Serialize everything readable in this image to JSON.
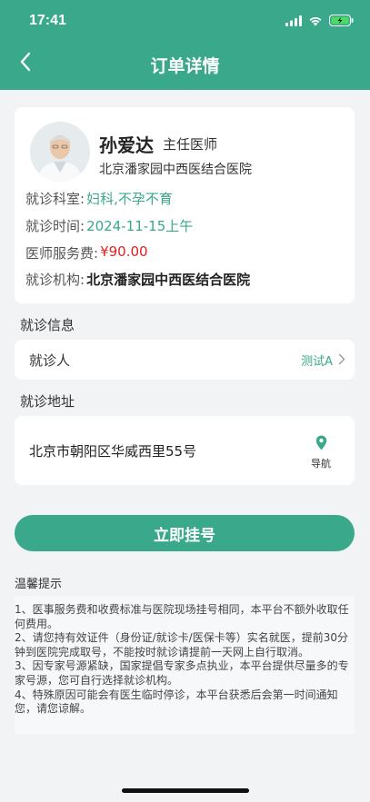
{
  "status_bar": {
    "time": "17:41"
  },
  "nav": {
    "title": "订单详情"
  },
  "doctor": {
    "name": "孙爱达",
    "title": "主任医师",
    "hospital": "北京潘家园中西医结合医院",
    "department_label": "就诊科室:",
    "department": "妇科,不孕不育",
    "time_label": "就诊时间:",
    "time": "2024-11-15上午",
    "fee_label": "医师服务费:",
    "fee": "¥90.00",
    "institution_label": "就诊机构:",
    "institution": "北京潘家园中西医结合医院"
  },
  "visit_info": {
    "section_title": "就诊信息",
    "patient_label": "就诊人",
    "patient_value": "测试A"
  },
  "address": {
    "section_title": "就诊地址",
    "text": "北京市朝阳区华威西里55号",
    "nav_label": "导航"
  },
  "register_button": "立即挂号",
  "tips": {
    "title": "温馨提示",
    "items": [
      "1、医事服务费和收费标准与医院现场挂号相同，本平台不额外收取任何费用。",
      "2、请您持有效证件（身份证/就诊卡/医保卡等）实名就医，提前30分钟到医院完成取号，不能按时就诊请提前一天网上自行取消。",
      "3、因专家号源紧缺，国家提倡专家多点执业，本平台提供尽量多的专家号源，您可自行选择就诊机构。",
      "4、特殊原因可能会有医生临时停诊，本平台获悉后会第一时间通知您，请您谅解。"
    ]
  },
  "colors": {
    "primary": "#3aa88a",
    "price": "#e02020",
    "background": "#f2f3f5"
  },
  "icons": [
    "back-arrow-icon",
    "signal-icon",
    "wifi-icon",
    "battery-icon",
    "location-pin-icon",
    "chevron-right-icon"
  ]
}
